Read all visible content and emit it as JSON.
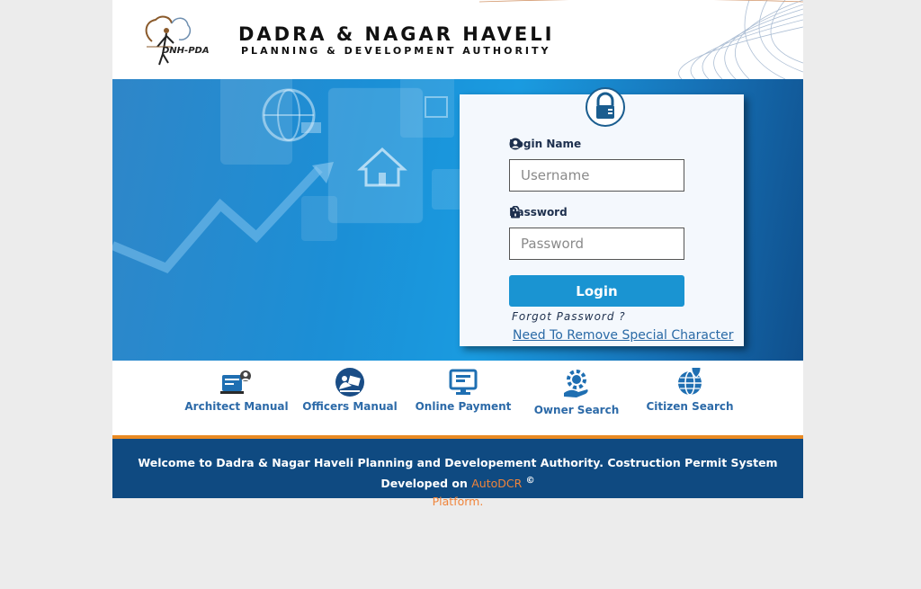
{
  "header": {
    "logo_text": "DNH-PDA",
    "title": "DADRA & NAGAR HAVELI",
    "subtitle": "PLANNING & DEVELOPMENT AUTHORITY"
  },
  "login": {
    "username_label": "Login Name",
    "username_placeholder": "Username",
    "password_label": "Password",
    "password_placeholder": "Password",
    "login_button": "Login",
    "forgot_password": "Forgot Password ?",
    "special_char_link": "Need To Remove Special Character"
  },
  "quick_links": [
    {
      "label": "Architect Manual",
      "icon": "architect-manual-icon"
    },
    {
      "label": "Officers Manual",
      "icon": "officers-manual-icon"
    },
    {
      "label": "Online Payment",
      "icon": "online-payment-icon"
    },
    {
      "label": "Owner Search",
      "icon": "owner-search-icon"
    },
    {
      "label": "Citizen Search",
      "icon": "citizen-search-icon"
    }
  ],
  "footer": {
    "text": "Welcome to Dadra & Nagar Haveli Planning and Developement Authority. Costruction Permit System Developed on",
    "brand": "AutoDCR",
    "copyright": "©",
    "platform": "Platform."
  },
  "colors": {
    "accent_blue": "#1a94d2",
    "footer_bg": "#0f4a81",
    "footer_border": "#e98a23",
    "link_text": "#2c6aa8",
    "brand_orange": "#f0843a"
  }
}
